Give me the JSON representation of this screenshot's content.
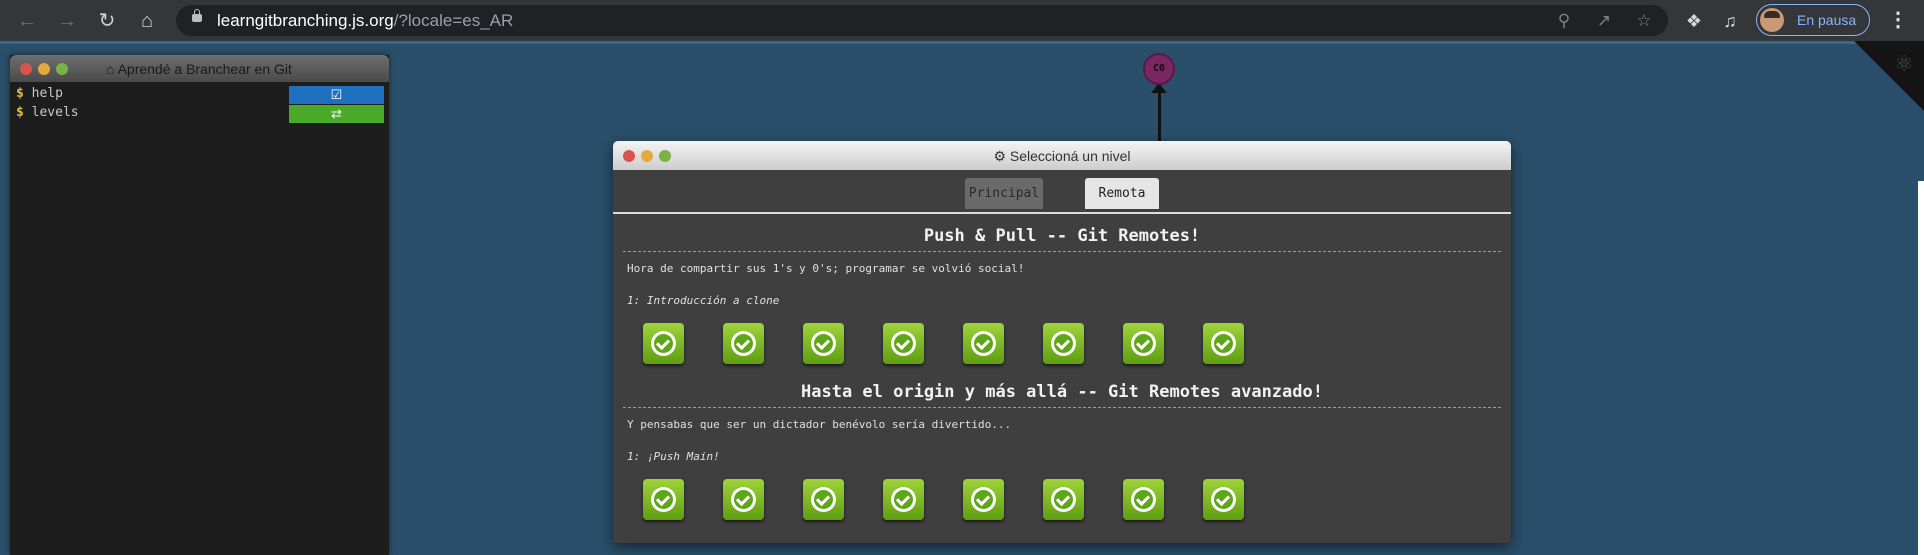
{
  "browser": {
    "url_host": "learngitbranching.js.org",
    "url_rest": "/?locale=es_AR",
    "profile_label": "En pausa",
    "icons": [
      "back-icon",
      "forward-icon",
      "reload-icon",
      "home-icon",
      "lock-icon",
      "zoom-icon",
      "share-icon",
      "star-icon",
      "puzzle-icon",
      "media-icon",
      "kebab-menu-icon"
    ]
  },
  "terminal": {
    "title": "Aprendé a Branchear en Git",
    "lines": [
      {
        "prompt": "$",
        "command": "help"
      },
      {
        "prompt": "$",
        "command": "levels"
      }
    ],
    "status_colors": {
      "help": "#1f6fbf",
      "levels": "#4caa2a"
    }
  },
  "graph": {
    "commit_label": "C0",
    "commit_color": "#7a2660"
  },
  "modal": {
    "title": "Seleccioná un nivel",
    "tabs": [
      "Principal",
      "Remota"
    ],
    "active_tab": "Remota",
    "sections": [
      {
        "title": "Push & Pull -- Git Remotes!",
        "description": "Hora de compartir sus 1's y 0's; programar se volvió social!",
        "subtitle": "1: Introducción a clone",
        "levels_completed": 8
      },
      {
        "title": "Hasta el origin y más allá -- Git Remotes avanzado!",
        "description": "Y pensabas que ser un dictador benévolo sería divertido...",
        "subtitle": "1: ¡Push Main!",
        "levels_completed": 8
      }
    ]
  },
  "colors": {
    "page_background": "#2a4f6a",
    "level_complete": "#7cbf1f"
  }
}
